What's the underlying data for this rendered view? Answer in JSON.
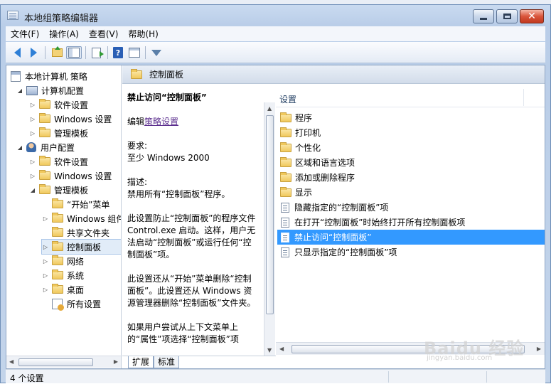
{
  "window": {
    "title": "本地组策略编辑器",
    "controls": {
      "minimize": "minimize-icon",
      "maximize": "maximize-icon",
      "close": "✕"
    }
  },
  "menu": [
    "文件(F)",
    "操作(A)",
    "查看(V)",
    "帮助(H)"
  ],
  "toolbar": [
    "back-icon",
    "forward-icon",
    "folder-up-icon",
    "show-tree-icon",
    "export-icon",
    "help-icon",
    "properties-icon",
    "filter-icon"
  ],
  "tree": {
    "root": "本地计算机 策略",
    "items": [
      {
        "label": "计算机配置",
        "icon": "computer-icon",
        "expander": "◢"
      },
      {
        "label": "软件设置",
        "icon": "folder-icon",
        "expander": "▷"
      },
      {
        "label": "Windows 设置",
        "icon": "folder-icon",
        "expander": "▷"
      },
      {
        "label": "管理模板",
        "icon": "folder-icon",
        "expander": "▷"
      },
      {
        "label": "用户配置",
        "icon": "user-icon",
        "expander": "◢"
      },
      {
        "label": "软件设置",
        "icon": "folder-icon",
        "expander": "▷"
      },
      {
        "label": "Windows 设置",
        "icon": "folder-icon",
        "expander": "▷"
      },
      {
        "label": "管理模板",
        "icon": "folder-icon",
        "expander": "◢"
      },
      {
        "label": "“开始”菜单",
        "icon": "folder-icon",
        "expander": ""
      },
      {
        "label": "Windows 组件",
        "icon": "folder-icon",
        "expander": "▷"
      },
      {
        "label": "共享文件夹",
        "icon": "folder-icon",
        "expander": ""
      },
      {
        "label": "控制面板",
        "icon": "folder-icon",
        "expander": "▷"
      },
      {
        "label": "网络",
        "icon": "folder-icon",
        "expander": "▷"
      },
      {
        "label": "系统",
        "icon": "folder-icon",
        "expander": "▷"
      },
      {
        "label": "桌面",
        "icon": "folder-icon",
        "expander": "▷"
      },
      {
        "label": "所有设置",
        "icon": "all-settings-icon",
        "expander": ""
      }
    ]
  },
  "header": {
    "title": "控制面板"
  },
  "description": {
    "title": "禁止访问“控制面板”",
    "edit_prefix": "编辑",
    "edit_link": "策略设置",
    "req_label": "要求:",
    "req_value": "至少 Windows 2000",
    "desc_label": "描述:",
    "desc_value": "禁用所有“控制面板”程序。",
    "para1": "此设置防止“控制面板”的程序文件 Control.exe 启动。这样，用户无法启动“控制面板”或运行任何“控制面板”项。",
    "para2": "此设置还从“开始”菜单删除“控制面板”。此设置还从 Windows 资源管理器删除“控制面板”文件夹。",
    "para3": "如果用户尝试从上下文菜单上的“属性”项选择“控制面板”项"
  },
  "list": {
    "column": "设置",
    "items": [
      {
        "label": "程序",
        "type": "folder"
      },
      {
        "label": "打印机",
        "type": "folder"
      },
      {
        "label": "个性化",
        "type": "folder"
      },
      {
        "label": "区域和语言选项",
        "type": "folder"
      },
      {
        "label": "添加或删除程序",
        "type": "folder"
      },
      {
        "label": "显示",
        "type": "folder"
      },
      {
        "label": "隐藏指定的“控制面板”项",
        "type": "setting"
      },
      {
        "label": "在打开“控制面板”时始终打开所有控制面板项",
        "type": "setting"
      },
      {
        "label": "禁止访问“控制面板”",
        "type": "setting"
      },
      {
        "label": "只显示指定的“控制面板”项",
        "type": "setting"
      }
    ]
  },
  "tabs": [
    "扩展",
    "标准"
  ],
  "status": {
    "text": "4 个设置"
  },
  "watermark": {
    "text": "Baidu 经验",
    "sub": "jingyan.baidu.com"
  },
  "colors": {
    "selection": "#3399ff",
    "link": "#5b2e8e"
  }
}
